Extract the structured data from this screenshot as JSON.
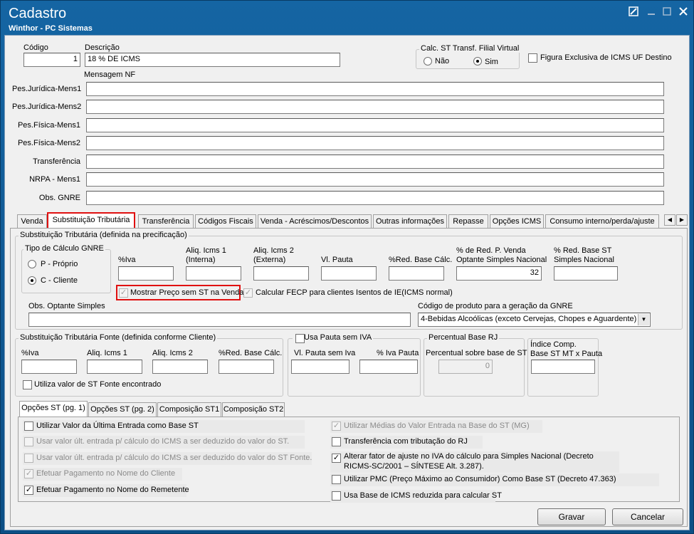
{
  "window": {
    "title": "Cadastro",
    "subtitle": "Winthor - PC Sistemas"
  },
  "header": {
    "codigo_label": "Código",
    "codigo_value": "1",
    "descricao_label": "Descrição",
    "descricao_value": "18 % DE ICMS",
    "calc_st_group": "Calc. ST Transf. Filial Virtual",
    "radio_nao": "Não",
    "radio_sim": "Sim",
    "figura_exclusiva": "Figura Exclusiva de ICMS UF Destino",
    "mensagem_nf_label": "Mensagem NF"
  },
  "messages": [
    {
      "label": "Pes.Jurídica-Mens1",
      "value": ""
    },
    {
      "label": "Pes.Jurídica-Mens2",
      "value": ""
    },
    {
      "label": "Pes.Física-Mens1",
      "value": ""
    },
    {
      "label": "Pes.Física-Mens2",
      "value": ""
    },
    {
      "label": "Transferência",
      "value": ""
    },
    {
      "label": "NRPA - Mens1",
      "value": ""
    },
    {
      "label": "Obs. GNRE",
      "value": ""
    }
  ],
  "tabs": [
    "Venda",
    "Substituição Tributária",
    "Transferência",
    "Códigos Fiscais",
    "Venda - Acréscimos/Descontos",
    "Outras informações",
    "Repasse",
    "Opções ICMS",
    "Consumo interno/perda/ajuste"
  ],
  "st": {
    "group_title": "Substituição Tributária (definida na precificação)",
    "tipo_calculo_title": "Tipo de Cálculo GNRE",
    "radio_proprio": "P - Próprio",
    "radio_cliente": "C - Cliente",
    "col_iva": "%Iva",
    "col_aliq1_a": "Aliq. Icms 1",
    "col_aliq1_b": "(Interna)",
    "col_aliq2_a": "Aliq. Icms 2",
    "col_aliq2_b": "(Externa)",
    "col_vl_pauta": "Vl. Pauta",
    "col_red_base": "%Red. Base Cálc.",
    "col_red_venda_a": "% de Red. P. Venda",
    "col_red_venda_b": "Optante Simples Nacional",
    "col_red_base_st_a": "% Red. Base ST",
    "col_red_base_st_b": "Simples Nacional",
    "red_venda_value": "32",
    "mostrar_preco": "Mostrar Preço sem ST na Venda",
    "calcular_fecp": "Calcular FECP para clientes Isentos de IE(ICMS normal)",
    "obs_optante_label": "Obs. Optante Simples",
    "codigo_produto_label": "Código de produto para a geração da GNRE",
    "codigo_produto_value": "4-Bebidas Alcoólicas (exceto Cervejas, Chopes e Aguardente)"
  },
  "st_fonte": {
    "group_title": "Substituição Tributária Fonte (definida conforme Cliente)",
    "col_iva": "%Iva",
    "col_aliq1": "Aliq. Icms 1",
    "col_aliq2": "Aliq. Icms 2",
    "col_red_base": "%Red. Base Cálc.",
    "utiliza_valor": "Utiliza valor de ST Fonte encontrado"
  },
  "pauta": {
    "group_title": "Usa Pauta sem IVA",
    "col_vl_pauta": "Vl. Pauta sem Iva",
    "col_iva_pauta": "% Iva Pauta"
  },
  "percentual_rj": {
    "group_title": "Percentual Base RJ",
    "label": "Percentual sobre base de ST",
    "value": "0"
  },
  "indice": {
    "label_a": "Índice Comp.",
    "label_b": "Base ST MT x Pauta"
  },
  "subtabs": [
    "Opções ST (pg. 1)",
    "Opções ST (pg. 2)",
    "Composição ST1",
    "Composição ST2"
  ],
  "options_left": [
    {
      "text": "Utilizar Valor da Última Entrada como Base ST",
      "checked": false,
      "disabled": false
    },
    {
      "text": "Usar valor últ. entrada p/ cálculo do ICMS a ser deduzido do valor do ST.",
      "checked": false,
      "disabled": true
    },
    {
      "text": "Usar valor últ. entrada p/ cálculo do ICMS a ser deduzido do valor do ST Fonte.",
      "checked": false,
      "disabled": true
    },
    {
      "text": "Efetuar Pagamento no Nome do Cliente",
      "checked": true,
      "disabled": true
    },
    {
      "text": "Efetuar Pagamento no Nome do Remetente",
      "checked": true,
      "disabled": false
    }
  ],
  "options_right": [
    {
      "text": "Utilizar Médias do Valor Entrada na Base do ST (MG)",
      "checked": true,
      "disabled": true
    },
    {
      "text": "Transferência com tributação do RJ",
      "checked": false,
      "disabled": false
    },
    {
      "text": "Alterar fator de ajuste no IVA do cálculo para Simples Nacional (Decreto",
      "text2": "RICMS-SC/2001 – SÍNTESE Alt. 3.287).",
      "checked": true,
      "disabled": false
    },
    {
      "text": "Utilizar PMC (Preço Máximo ao Consumidor) Como Base ST (Decreto 47.363)",
      "checked": false,
      "disabled": false
    },
    {
      "text": "Usa Base de ICMS reduzida para calcular ST",
      "checked": false,
      "disabled": false
    }
  ],
  "buttons": {
    "gravar": "Gravar",
    "cancelar": "Cancelar"
  }
}
